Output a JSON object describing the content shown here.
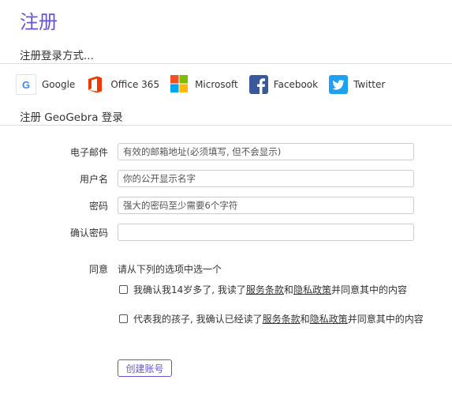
{
  "page_title": "注册",
  "providers_section": {
    "title": "注册登录方式...",
    "items": [
      {
        "id": "google",
        "label": "Google",
        "icon": "google-icon"
      },
      {
        "id": "office365",
        "label": "Office 365",
        "icon": "office365-icon"
      },
      {
        "id": "microsoft",
        "label": "Microsoft",
        "icon": "microsoft-icon"
      },
      {
        "id": "facebook",
        "label": "Facebook",
        "icon": "facebook-icon"
      },
      {
        "id": "twitter",
        "label": "Twitter",
        "icon": "twitter-icon"
      }
    ],
    "google_glyph": "G"
  },
  "geogebra_section": {
    "title": "注册 GeoGebra 登录"
  },
  "form": {
    "email": {
      "label": "电子邮件",
      "placeholder": "有效的邮箱地址(必须填写, 但不会显示)",
      "value": ""
    },
    "username": {
      "label": "用户名",
      "placeholder": "你的公开显示名字",
      "value": ""
    },
    "password": {
      "label": "密码",
      "placeholder": "强大的密码至少需要6个字符",
      "value": ""
    },
    "confirm": {
      "label": "确认密码",
      "placeholder": "",
      "value": ""
    }
  },
  "agree": {
    "label": "同意",
    "hint": "请从下列的选项中选一个",
    "option1": {
      "pre": "我确认我14岁多了, 我读了",
      "terms": "服务条款",
      "and": "和",
      "privacy": "隐私政策",
      "post": "并同意其中的内容"
    },
    "option2": {
      "pre": "代表我的孩子, 我确认已经读了",
      "terms": "服务条款",
      "and": "和",
      "privacy": "隐私政策",
      "post": "并同意其中的内容"
    }
  },
  "create_button": "创建账号",
  "colors": {
    "accent": "#6557d2",
    "facebook": "#3b5998",
    "twitter": "#1da1f2",
    "office_orange": "#eb3c00",
    "ms_red": "#f25022",
    "ms_green": "#7fba00",
    "ms_blue": "#00a4ef",
    "ms_yellow": "#ffb900"
  }
}
